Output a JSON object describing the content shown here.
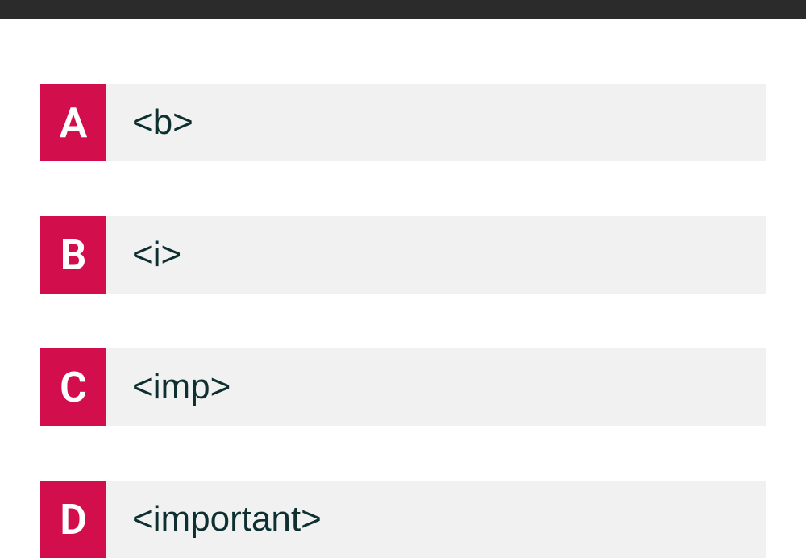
{
  "options": [
    {
      "letter": "A",
      "text": "<b>"
    },
    {
      "letter": "B",
      "text": "<i>"
    },
    {
      "letter": "C",
      "text": "<imp>"
    },
    {
      "letter": "D",
      "text": "<important>"
    }
  ]
}
